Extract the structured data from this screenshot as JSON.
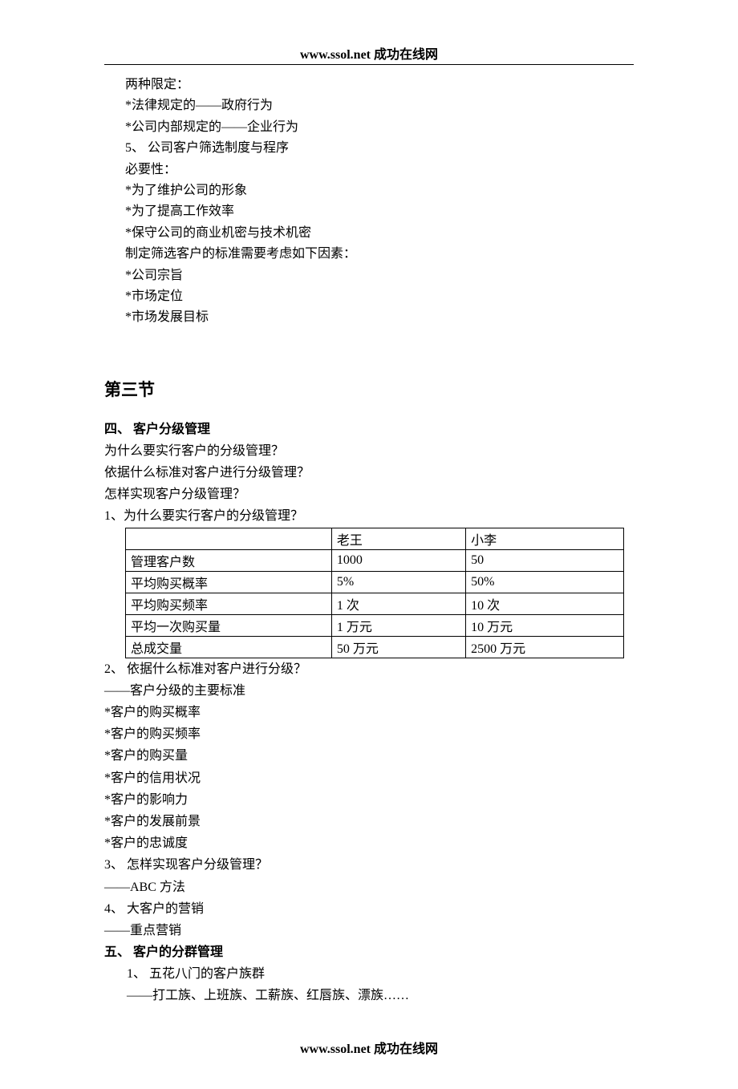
{
  "header": "www.ssol.net    成功在线网",
  "top_block": [
    "两种限定：",
    "*法律规定的——政府行为",
    "*公司内部规定的——企业行为",
    "5、 公司客户筛选制度与程序",
    "必要性：",
    "*为了维护公司的形象",
    "*为了提高工作效率",
    "*保守公司的商业机密与技术机密",
    "制定筛选客户的标准需要考虑如下因素：",
    "*公司宗旨",
    "*市场定位",
    "*市场发展目标"
  ],
  "section_title": "第三节",
  "h4": "四、        客户分级管理",
  "q_block": [
    "为什么要实行客户的分级管理？",
    "依据什么标准对客户进行分级管理？",
    "怎样实现客户分级管理？",
    "1、为什么要实行客户的分级管理？"
  ],
  "table": {
    "rows": [
      [
        "",
        "老王",
        "小李"
      ],
      [
        "管理客户数",
        "1000",
        "50"
      ],
      [
        "平均购买概率",
        "5%",
        "50%"
      ],
      [
        "平均购买频率",
        "1 次",
        "10 次"
      ],
      [
        "平均一次购买量",
        "1 万元",
        "10 万元"
      ],
      [
        "总成交量",
        "50 万元",
        "2500 万元"
      ]
    ]
  },
  "after_table": [
    "2、 依据什么标准对客户进行分级？",
    "——客户分级的主要标准",
    "*客户的购买概率",
    "*客户的购买频率",
    "*客户的购买量",
    "*客户的信用状况",
    "*客户的影响力",
    "*客户的发展前景",
    "*客户的忠诚度",
    "3、 怎样实现客户分级管理？",
    "——ABC 方法",
    "4、 大客户的营销",
    "——重点营销"
  ],
  "h5": "五、        客户的分群管理",
  "h5_block": [
    "1、 五花八门的客户族群",
    "——打工族、上班族、工薪族、红唇族、漂族……"
  ],
  "footer": "www.ssol.net    成功在线网"
}
